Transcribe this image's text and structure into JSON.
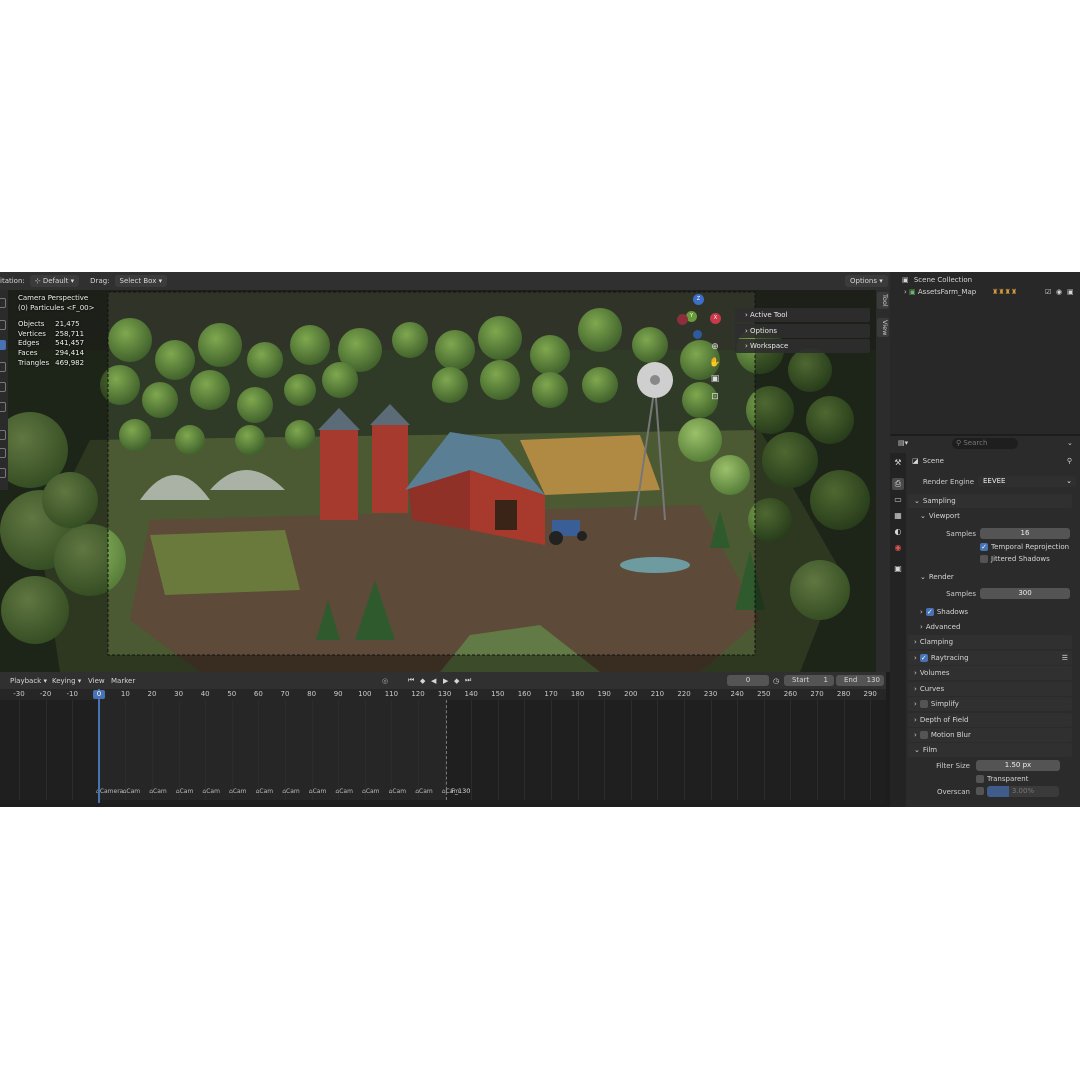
{
  "header": {
    "orientation_label": "itation:",
    "orientation_value": "Default",
    "drag_label": "Drag:",
    "drag_value": "Select Box",
    "options_label": "Options"
  },
  "viewport": {
    "camera_title": "Camera Perspective",
    "camera_sub": "(0) Particules <F_00>",
    "stats": [
      {
        "k": "Objects",
        "v": "21,475"
      },
      {
        "k": "Vertices",
        "v": "258,711"
      },
      {
        "k": "Edges",
        "v": "541,457"
      },
      {
        "k": "Faces",
        "v": "294,414"
      },
      {
        "k": "Triangles",
        "v": "469,982"
      }
    ],
    "npanel": [
      "Active Tool",
      "Options",
      "Workspace"
    ],
    "side_tabs": [
      "Tool",
      "View"
    ],
    "gizmo": {
      "z": "Z",
      "y": "Y",
      "x": "X"
    }
  },
  "timeline": {
    "menus": [
      "Playback",
      "Keying",
      "View",
      "Marker"
    ],
    "current_frame": "0",
    "start_label": "Start",
    "start_value": "1",
    "end_label": "End",
    "end_value": "130",
    "ticks": [
      "-30",
      "-20",
      "-10",
      "0",
      "10",
      "20",
      "30",
      "40",
      "50",
      "60",
      "70",
      "80",
      "90",
      "100",
      "110",
      "120",
      "130",
      "140",
      "150",
      "160",
      "170",
      "180",
      "190",
      "200",
      "210",
      "220",
      "230",
      "240",
      "250",
      "260",
      "270",
      "280",
      "290"
    ],
    "markers": [
      "Camera",
      "Cam",
      "Cam",
      "Cam",
      "Cam",
      "Cam",
      "Cam",
      "Cam",
      "Cam",
      "Cam",
      "Cam",
      "Cam",
      "Cam",
      "Cam"
    ],
    "end_marker": "F_130"
  },
  "outliner": {
    "root": "Scene Collection",
    "child": "AssetsFarm_Map"
  },
  "properties": {
    "search_placeholder": "Search",
    "scene_label": "Scene",
    "render_engine_label": "Render Engine",
    "render_engine_value": "EEVEE",
    "sampling": "Sampling",
    "viewport": "Viewport",
    "samples_label": "Samples",
    "viewport_samples": "16",
    "temporal": "Temporal Reprojection",
    "jittered": "Jittered Shadows",
    "render": "Render",
    "render_samples": "300",
    "shadows": "Shadows",
    "advanced": "Advanced",
    "clamping": "Clamping",
    "raytracing": "Raytracing",
    "volumes": "Volumes",
    "curves": "Curves",
    "simplify": "Simplify",
    "dof": "Depth of Field",
    "motion_blur": "Motion Blur",
    "film": "Film",
    "filter_size_label": "Filter Size",
    "filter_size_value": "1.50 px",
    "transparent": "Transparent",
    "overscan_label": "Overscan",
    "overscan_value": "3.00%"
  },
  "colors": {
    "accent": "#4772b3",
    "playhead": "#4772b3",
    "field": "#545454"
  }
}
